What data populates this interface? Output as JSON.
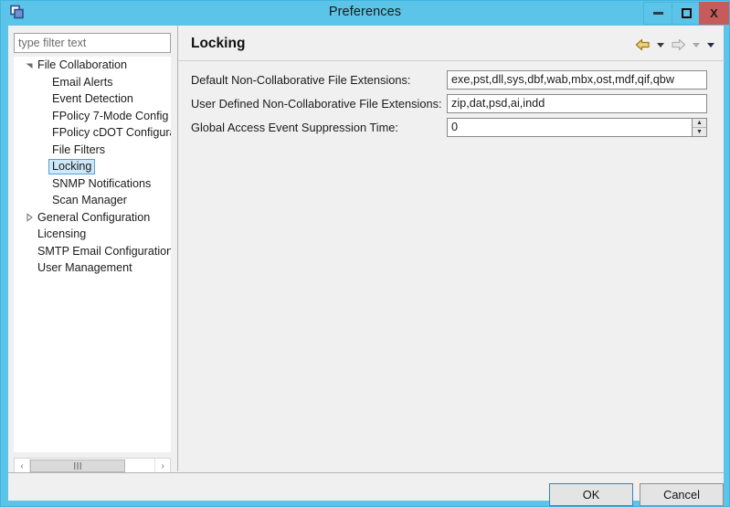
{
  "window": {
    "title": "Preferences",
    "app_icon": "windows-overlap-icon",
    "controls": {
      "minimize": "minimize-icon",
      "maximize": "maximize-icon",
      "close": "X"
    },
    "colors": {
      "titlebar": "#5bc4e8",
      "close_button": "#c75b5b",
      "panel": "#f0f0f0",
      "selection": "#cde8f7",
      "selection_border": "#5a9fd4",
      "focus_border": "#2e86c8",
      "back_arrow": "#d9a520"
    }
  },
  "filter": {
    "placeholder": "type filter text",
    "value": ""
  },
  "tree": {
    "items": [
      {
        "label": "File Collaboration",
        "level": 1,
        "twisty": "expanded",
        "selected": false
      },
      {
        "label": "Email Alerts",
        "level": 2,
        "twisty": "none",
        "selected": false
      },
      {
        "label": "Event Detection",
        "level": 2,
        "twisty": "none",
        "selected": false
      },
      {
        "label": "FPolicy 7-Mode Config",
        "level": 2,
        "twisty": "none",
        "selected": false
      },
      {
        "label": "FPolicy cDOT Configuration",
        "level": 2,
        "twisty": "none",
        "selected": false
      },
      {
        "label": "File Filters",
        "level": 2,
        "twisty": "none",
        "selected": false
      },
      {
        "label": "Locking",
        "level": 2,
        "twisty": "none",
        "selected": true
      },
      {
        "label": "SNMP Notifications",
        "level": 2,
        "twisty": "none",
        "selected": false
      },
      {
        "label": "Scan Manager",
        "level": 2,
        "twisty": "none",
        "selected": false
      },
      {
        "label": "General Configuration",
        "level": 1,
        "twisty": "collapsed",
        "selected": false
      },
      {
        "label": "Licensing",
        "level": 1,
        "twisty": "none",
        "selected": false
      },
      {
        "label": "SMTP Email Configuration",
        "level": 1,
        "twisty": "none",
        "selected": false
      },
      {
        "label": "User Management",
        "level": 1,
        "twisty": "none",
        "selected": false
      }
    ]
  },
  "tree_scrollbar": {
    "left_arrow": "‹",
    "right_arrow": "›",
    "thumb_grip": "‖‖"
  },
  "content": {
    "heading": "Locking",
    "nav": {
      "back_icon": "back-arrow-icon",
      "back_menu_icon": "chevron-down-icon",
      "forward_icon": "forward-arrow-icon",
      "forward_menu_icon": "chevron-down-icon",
      "view_menu_icon": "chevron-down-icon"
    },
    "fields": [
      {
        "label": "Default Non-Collaborative File Extensions:",
        "value": "exe,pst,dll,sys,dbf,wab,mbx,ost,mdf,qif,qbw",
        "type": "text"
      },
      {
        "label": "User Defined Non-Collaborative File Extensions:",
        "value": "zip,dat,psd,ai,indd",
        "type": "text"
      },
      {
        "label": "Global Access Event Suppression Time:",
        "value": "0",
        "type": "spinner",
        "spinner_up": "▲",
        "spinner_down": "▼"
      }
    ]
  },
  "footer": {
    "ok_label": "OK",
    "cancel_label": "Cancel"
  }
}
